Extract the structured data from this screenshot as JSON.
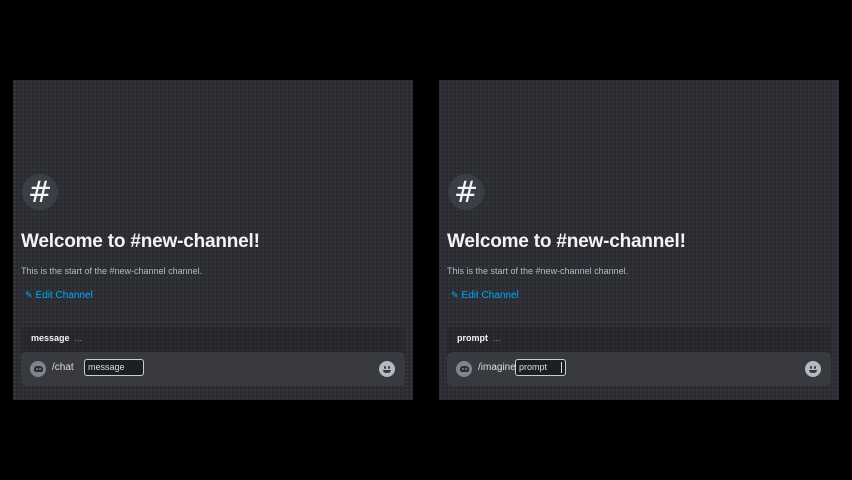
{
  "panels": [
    {
      "hash_glyph": "#",
      "welcome": "Welcome to #new-channel!",
      "subtitle": "This is the start of the #new-channel channel.",
      "edit_label": "Edit Channel",
      "option_hint_name": "message",
      "option_hint_dots": "...",
      "command": "/chat",
      "option_chip": "message"
    },
    {
      "hash_glyph": "#",
      "welcome": "Welcome to #new-channel!",
      "subtitle": "This is the start of the #new-channel channel.",
      "edit_label": "Edit Channel",
      "option_hint_name": "prompt",
      "option_hint_dots": "...",
      "command": "/imagine",
      "option_chip": "prompt"
    }
  ],
  "icons": {
    "hash": "channel-hash-icon",
    "pencil": "pencil-icon",
    "bot": "bot-avatar-icon",
    "emoji": "emoji-smile-icon"
  },
  "colors": {
    "background": "#000000",
    "panel": "#2a2c32",
    "link": "#00a8fc",
    "composer": "#383a40"
  }
}
